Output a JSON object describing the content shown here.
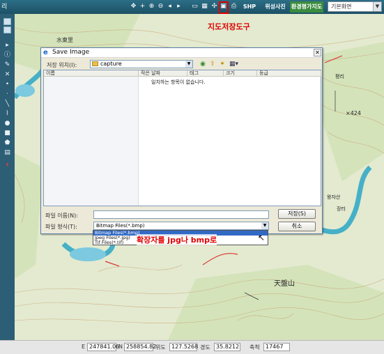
{
  "app": {
    "title_fragment": "리"
  },
  "toolbar": {
    "shp_label": "SHP",
    "satellite_tab": "위성사진",
    "env_map_tab": "환경평가지도",
    "map_select_value": "기본화면"
  },
  "annotations": {
    "save_tool_callout": "지도저장도구",
    "extension_callout": "확장자를 jpg나 bmp로",
    "color": "#e00000"
  },
  "dialog": {
    "title": "Save Image",
    "save_in_label": "저장 위치(I):",
    "folder_name": "capture",
    "columns": [
      "이름",
      "작은 날짜",
      "태그",
      "크기",
      "등급"
    ],
    "empty_message": "일치하는 항목이 없습니다.",
    "filename_label": "파일 이름(N):",
    "filename_value": "",
    "filetype_label": "파일 형식(T):",
    "filetype_value": "Bitmap Files(*.bmp)",
    "save_button": "저장(S)",
    "cancel_button": "취소",
    "filetype_options": [
      "Bitmap Files(*.bmp)",
      "Jpeg Files(*.jpg)",
      "Tif Files(*.tif)"
    ]
  },
  "map": {
    "labels": [
      "水東里",
      "天盤山",
      "×424",
      "평리",
      "왕자산",
      "장터"
    ]
  },
  "status": {
    "x_label": "E",
    "x_value": "247841.06",
    "y_label": "N",
    "y_value": "258854.82",
    "lat_label": "위도",
    "lat_value": "127.5268",
    "lon_label": "경도",
    "lon_value": "35.8212",
    "scale_label": "축척",
    "scale_value": "17467"
  }
}
